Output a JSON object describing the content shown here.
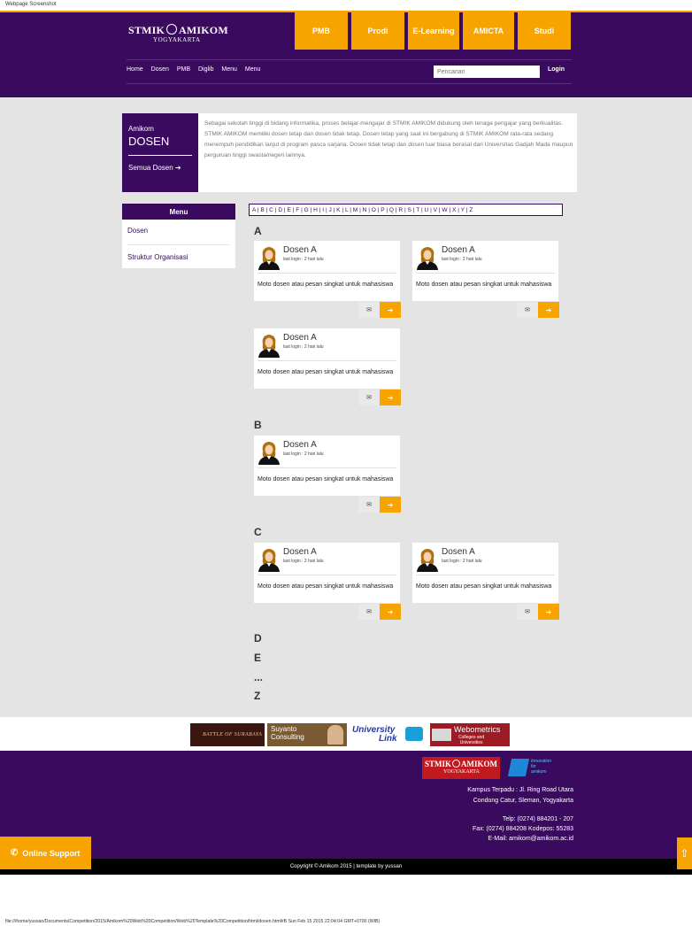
{
  "caption": "Webpage Screenshot",
  "header": {
    "logo_text": "STMIK",
    "logo_text2": "AMIKOM",
    "logo_subtitle": "YOGYAKARTA",
    "tiles": [
      "PMB",
      "Prodi",
      "E-Learning",
      "AMICTA",
      "Studi"
    ],
    "subnav": [
      "Home",
      "Dosen",
      "PMB",
      "Diglib",
      "Menu",
      "Menu"
    ],
    "search_placeholder": "Pencarian",
    "login_label": "Login"
  },
  "intro": {
    "small_title": "Amikom",
    "big_title": "DOSEN",
    "all_link": "Semua Dosen ➔",
    "text": "Sebagai sekolah tinggi di bidang informatika, proses belajar-mengajar di STMIK AMIKOM didukung oleh tenaga pengajar yang berkualitas. STMIK AMIKOM memiliki dosen tetap dan dosen tidak tetap. Dosen tetap yang saat ini bergabung di STMIK AMIKOM rata-rata sedang menempuh pendidikan lanjut di program pasca sarjana. Dosen tidak tetap dan dosen luar biasa berasal dari Universitas Gadjah Mada maupun perguruan tinggi swasta/negeri lainnya."
  },
  "menu": {
    "title": "Menu",
    "items": [
      "Dosen",
      "Struktur Organisasi"
    ]
  },
  "alphabet": "A | B | C | D | E | F | G | H | I | J | K | L | M | N | O | P | Q | R | S | T | U | V | W | X | Y | Z",
  "card": {
    "name": "Dosen A",
    "last_login": "last login : 2 hari lalu",
    "moto": "Moto dosen atau pesan singkat untuk mahasiswa",
    "mail_icon": "✉",
    "go_icon": "➔"
  },
  "letters": [
    "A",
    "B",
    "C",
    "D",
    "E",
    "...",
    "Z"
  ],
  "partners": {
    "battle_title": "BATTLE OF SURABAYA",
    "suyanto_line1": "Suyanto",
    "suyanto_line2": "Consulting",
    "ulink_line1": "University",
    "ulink_line2": "Link",
    "webo_title": "Webometrics",
    "webo_sub1": "Colleges and",
    "webo_sub2": "Universities"
  },
  "footer": {
    "logo_sub": "YOGYAKARTA",
    "badge_line1": "Innovation",
    "badge_line2": "for",
    "badge_line3": "amikom",
    "address1": "Kampus Terpadu : Jl. Ring Road Utara",
    "address2": "Condong Catur, Sleman, Yogyakarta",
    "telp": "Telp: (0274) 884201 - 207",
    "fax": "Fax: (0274) 884208 Kodepos: 55283",
    "email": "E-Mail: amikom@amikom.ac.id",
    "copyright": "Copyright © Amikom 2015 | template by yussan",
    "online_support": "Online Support",
    "phone_icon": "✆",
    "up_icon": "⇧"
  },
  "status_url": "file:///home/yussan/Documents/Competition/2015/Amikom%20Web%20Competition/Web%20Template%20Competition/html/dosen.html#B Sun Feb 15 2015 22:04:04 GMT+0700 (WIB)"
}
